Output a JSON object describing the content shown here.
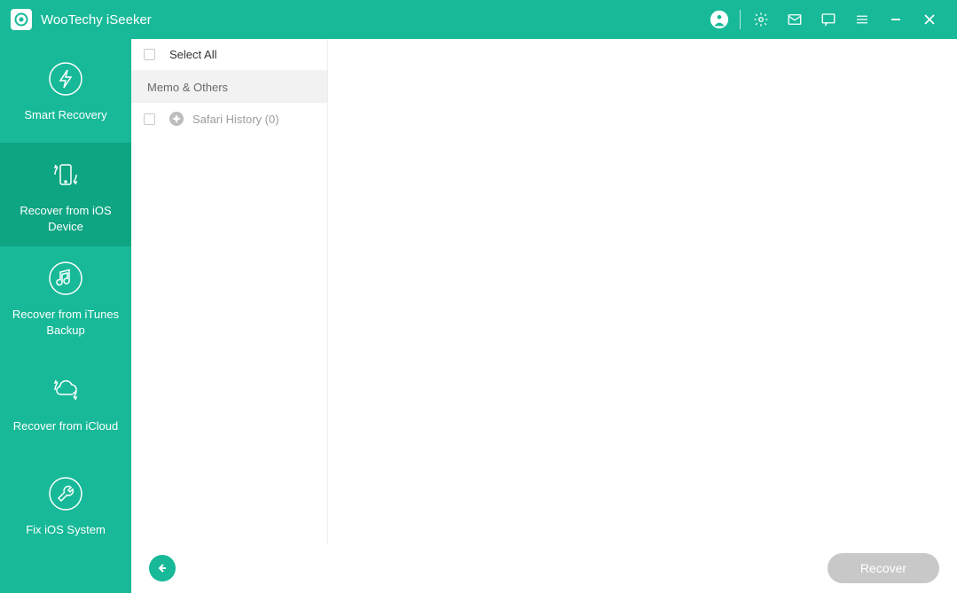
{
  "app": {
    "title": "WooTechy iSeeker"
  },
  "sidebar": {
    "items": [
      {
        "label": "Smart Recovery"
      },
      {
        "label": "Recover from iOS Device"
      },
      {
        "label": "Recover from iTunes Backup"
      },
      {
        "label": "Recover from iCloud"
      },
      {
        "label": "Fix iOS System"
      }
    ]
  },
  "list": {
    "selectAll": "Select All",
    "section": "Memo & Others",
    "item1": "Safari History (0)"
  },
  "footer": {
    "recover": "Recover"
  }
}
